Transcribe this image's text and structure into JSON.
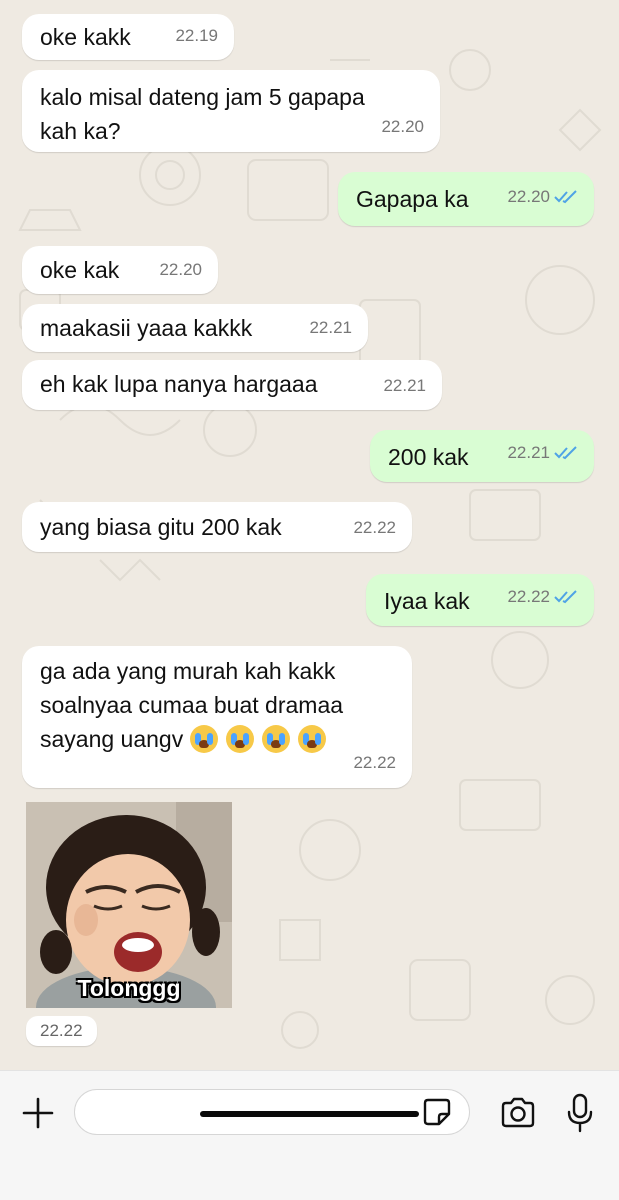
{
  "chat": {
    "messages": [
      {
        "text": "oke kakk",
        "time": "22.19",
        "direction": "incoming"
      },
      {
        "text": "kalo misal dateng jam 5 gapapa\nkah ka?",
        "time": "22.20",
        "direction": "incoming"
      },
      {
        "text": "Gapapa ka",
        "time": "22.20",
        "direction": "outgoing",
        "status": "read"
      },
      {
        "text": "oke kak",
        "time": "22.20",
        "direction": "incoming"
      },
      {
        "text": "maakasii yaaa kakkk",
        "time": "22.21",
        "direction": "incoming"
      },
      {
        "text": "eh kak lupa nanya hargaaa",
        "time": "22.21",
        "direction": "incoming"
      },
      {
        "text": "200 kak",
        "time": "22.21",
        "direction": "outgoing",
        "status": "read"
      },
      {
        "text": "yang biasa gitu 200 kak",
        "time": "22.22",
        "direction": "incoming"
      },
      {
        "text": "Iyaa kak",
        "time": "22.22",
        "direction": "outgoing",
        "status": "read"
      },
      {
        "text": "ga ada yang murah kah kakk\nsoalnyaa cumaa buat dramaa\nsayang uangv",
        "emoji": "loudly-crying-face",
        "emoji_count": 4,
        "time": "22.22",
        "direction": "incoming"
      }
    ],
    "sticker": {
      "caption": "Tolonggg",
      "time": "22.22",
      "direction": "incoming"
    }
  },
  "composer": {
    "input_value": "",
    "icons": [
      "plus-icon",
      "sticker-icon",
      "camera-icon",
      "microphone-icon"
    ]
  },
  "colors": {
    "wallpaper": "#efeae2",
    "incoming_bubble": "#ffffff",
    "outgoing_bubble": "#d9fdd3",
    "read_receipt": "#4fa3e6"
  }
}
